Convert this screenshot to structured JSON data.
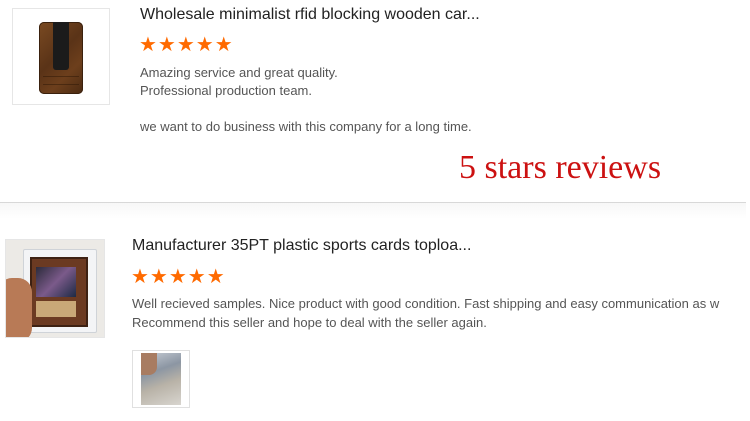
{
  "reviews": [
    {
      "title": "Wholesale minimalist rfid blocking wooden car...",
      "stars": "★★★★★",
      "rating": 5,
      "lines": [
        "Amazing service and great quality.",
        "Professional production team.",
        "we want to do business with this company for a long time."
      ]
    },
    {
      "title": "Manufacturer 35PT plastic sports cards toploa...",
      "stars": "★★★★★",
      "rating": 5,
      "lines": [
        "Well recieved samples. Nice product with good condition. Fast shipping and easy communication as w",
        "Recommend this seller and hope to deal with the seller again."
      ]
    }
  ],
  "overlay": {
    "text": "5 stars reviews"
  },
  "colors": {
    "star": "#ff6a00",
    "overlay_text": "#cc1111",
    "title_text": "#222222",
    "body_text": "#555555",
    "divider": "#d8d8d8"
  },
  "icons": {
    "star": "star-icon"
  }
}
